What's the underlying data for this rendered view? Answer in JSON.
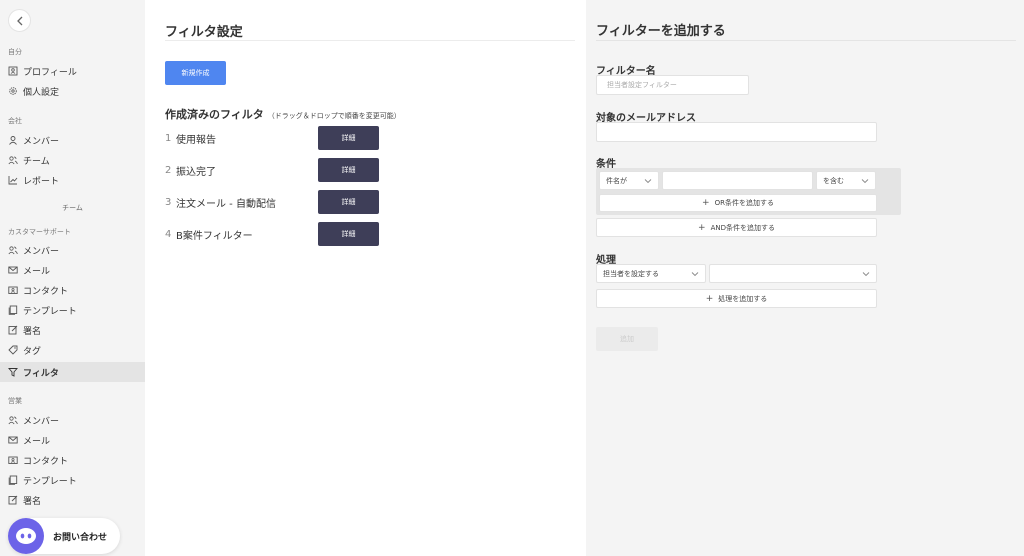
{
  "sidebar": {
    "section_self": "自分",
    "items_self": [
      {
        "label": "プロフィール",
        "icon": "profile-icon"
      },
      {
        "label": "個人設定",
        "icon": "gear-icon"
      }
    ],
    "section_company": "会社",
    "items_company": [
      {
        "label": "メンバー",
        "icon": "user-icon"
      },
      {
        "label": "チーム",
        "icon": "team-icon"
      },
      {
        "label": "レポート",
        "icon": "chart-icon"
      }
    ],
    "section_team": "チーム",
    "section_support": "カスタマーサポート",
    "items_support": [
      {
        "label": "メンバー",
        "icon": "team-icon"
      },
      {
        "label": "メール",
        "icon": "mail-icon"
      },
      {
        "label": "コンタクト",
        "icon": "contact-card-icon"
      },
      {
        "label": "テンプレート",
        "icon": "template-icon"
      },
      {
        "label": "署名",
        "icon": "edit-icon"
      },
      {
        "label": "タグ",
        "icon": "tag-icon"
      },
      {
        "label": "フィルタ",
        "icon": "filter-icon"
      }
    ],
    "section_sales": "営業",
    "items_sales": [
      {
        "label": "メンバー",
        "icon": "team-icon"
      },
      {
        "label": "メール",
        "icon": "mail-icon"
      },
      {
        "label": "コンタクト",
        "icon": "contact-card-icon"
      },
      {
        "label": "テンプレート",
        "icon": "template-icon"
      },
      {
        "label": "署名",
        "icon": "edit-icon"
      }
    ],
    "chat_label": "お問い合わせ"
  },
  "main": {
    "title": "フィルタ設定",
    "new_button": "新規作成",
    "list_heading": "作成済みのフィルタ",
    "list_note": "（ドラッグ＆ドロップで順番を変更可能）",
    "filters": [
      {
        "num": "1",
        "name": "使用報告",
        "button": "詳細"
      },
      {
        "num": "2",
        "name": "振込完了",
        "button": "詳細"
      },
      {
        "num": "3",
        "name": "注文メール - 自動配信",
        "button": "詳細"
      },
      {
        "num": "4",
        "name": "B案件フィルター",
        "button": "詳細"
      }
    ]
  },
  "panel": {
    "title": "フィルターを追加する",
    "name_label": "フィルター名",
    "name_placeholder": "担当者設定フィルター",
    "email_label": "対象のメールアドレス",
    "email_value": "",
    "condition_label": "条件",
    "condition_field": "件名が",
    "condition_value": "",
    "condition_op": "を含む",
    "or_button": "OR条件を追加する",
    "and_button": "AND条件を追加する",
    "action_label": "処理",
    "action_select": "担当者を設定する",
    "action_target": "",
    "action_add": "処理を追加する",
    "submit": "追加"
  },
  "colors": {
    "primary_button": "#4f86f0",
    "detail_button": "#3e3e58",
    "chat_avatar": "#6c63e8"
  }
}
